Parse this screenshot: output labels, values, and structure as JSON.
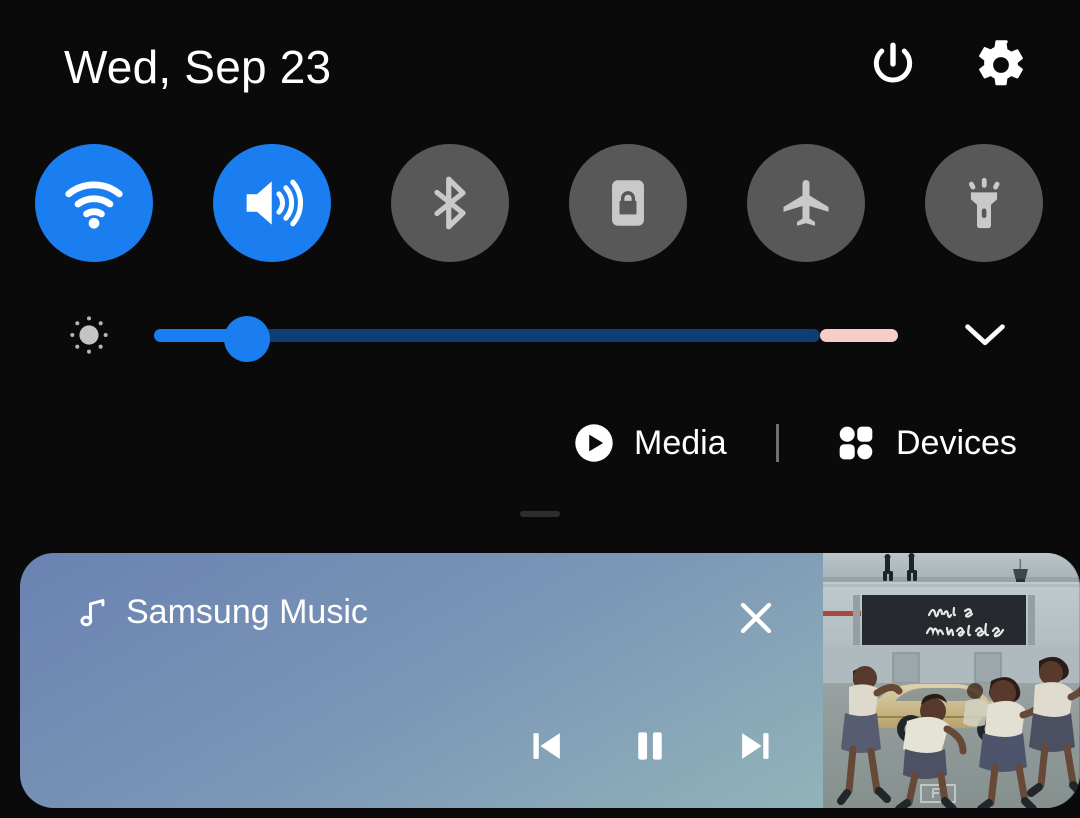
{
  "header": {
    "date": "Wed, Sep 23",
    "power_icon": "power-icon",
    "settings_icon": "gear-icon"
  },
  "quick_toggles": [
    {
      "name": "wifi",
      "icon": "wifi-icon",
      "state": "on",
      "color": "#1a7ef0"
    },
    {
      "name": "sound",
      "icon": "volume-icon",
      "state": "on",
      "color": "#1a7ef0"
    },
    {
      "name": "bluetooth",
      "icon": "bluetooth-icon",
      "state": "off",
      "color": "#585858"
    },
    {
      "name": "auto-rotate",
      "icon": "lock-icon",
      "state": "off",
      "color": "#585858"
    },
    {
      "name": "airplane",
      "icon": "airplane-icon",
      "state": "off",
      "color": "#585858"
    },
    {
      "name": "flashlight",
      "icon": "flashlight-icon",
      "state": "off",
      "color": "#585858"
    }
  ],
  "brightness": {
    "icon": "brightness-icon",
    "value_percent": 12,
    "filled_color": "#1a7ef0",
    "remaining_color": "#0e3f73",
    "tail_color": "#f6cdc8",
    "expand_icon": "chevron-down-icon"
  },
  "tabs": [
    {
      "label": "Media",
      "icon": "play-circle-icon",
      "selected": true
    },
    {
      "label": "Devices",
      "icon": "grid-dots-icon",
      "selected": false
    }
  ],
  "media_card": {
    "app_name": "Samsung Music",
    "app_icon": "music-note-icon",
    "close_icon": "close-icon",
    "playback_state": "playing",
    "controls": [
      {
        "name": "previous",
        "icon": "skip-previous-icon"
      },
      {
        "name": "play-pause",
        "icon": "pause-icon"
      },
      {
        "name": "next",
        "icon": "skip-next-icon"
      }
    ],
    "album_art": {
      "name": "album-art",
      "banner_text_line1": "this is",
      "banner_text_line2": "america"
    }
  }
}
